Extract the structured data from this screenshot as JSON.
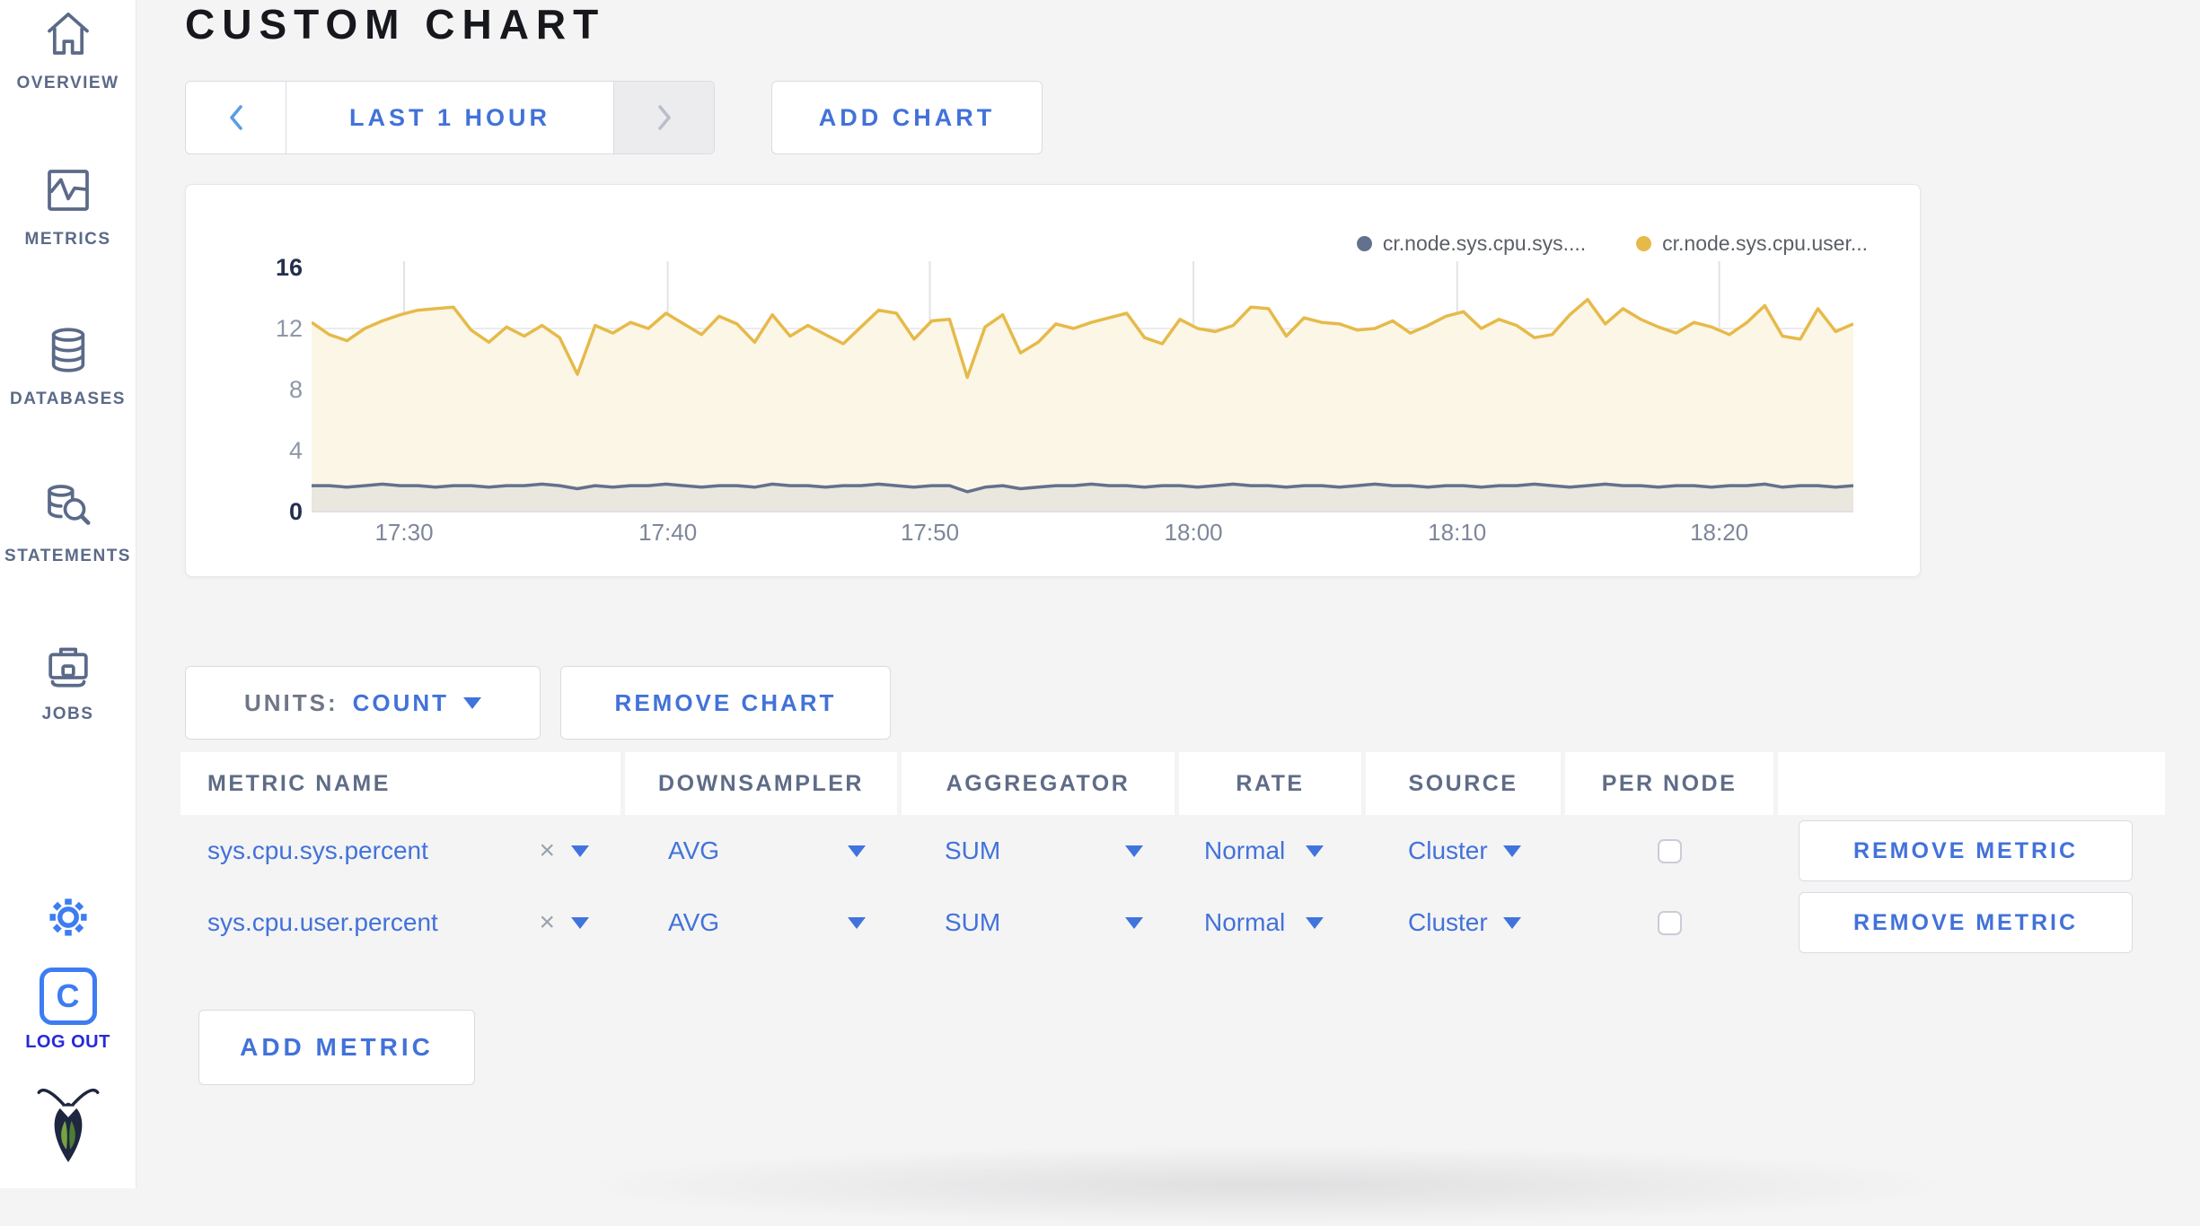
{
  "sidebar": {
    "items": [
      {
        "label": "OVERVIEW",
        "icon": "home-icon"
      },
      {
        "label": "METRICS",
        "icon": "metrics-icon"
      },
      {
        "label": "DATABASES",
        "icon": "databases-icon"
      },
      {
        "label": "STATEMENTS",
        "icon": "statements-icon"
      },
      {
        "label": "JOBS",
        "icon": "jobs-icon"
      }
    ],
    "logout_label": "LOG OUT",
    "logo_letter": "C"
  },
  "header": {
    "title": "CUSTOM CHART"
  },
  "toolbar": {
    "time_range_label": "LAST 1 HOUR",
    "add_chart_label": "ADD CHART"
  },
  "chart_controls": {
    "units_label": "UNITS:",
    "units_value": "COUNT",
    "remove_chart_label": "REMOVE CHART",
    "add_metric_label": "ADD METRIC"
  },
  "table": {
    "columns": [
      "METRIC NAME",
      "DOWNSAMPLER",
      "AGGREGATOR",
      "RATE",
      "SOURCE",
      "PER NODE"
    ],
    "rows": [
      {
        "metric": "sys.cpu.sys.percent",
        "clear": "×",
        "downsampler": "AVG",
        "aggregator": "SUM",
        "rate": "Normal",
        "source": "Cluster",
        "per_node_checked": false,
        "remove_label": "REMOVE METRIC"
      },
      {
        "metric": "sys.cpu.user.percent",
        "clear": "×",
        "downsampler": "AVG",
        "aggregator": "SUM",
        "rate": "Normal",
        "source": "Cluster",
        "per_node_checked": false,
        "remove_label": "REMOVE METRIC"
      }
    ]
  },
  "chart_data": {
    "type": "line",
    "title": "",
    "xlabel": "",
    "ylabel": "",
    "grid": true,
    "legend_position": "top-right",
    "y_ticks": [
      0,
      4,
      8,
      12,
      16
    ],
    "ylim": [
      0,
      16.5
    ],
    "x_ticks": [
      "17:30",
      "17:40",
      "17:50",
      "18:00",
      "18:10",
      "18:20"
    ],
    "x_tick_fractions": [
      0.06,
      0.231,
      0.401,
      0.572,
      0.743,
      0.913
    ],
    "series": [
      {
        "name": "cr.node.sys.cpu.sys....",
        "color": "#64718c",
        "fill": "#eae7df",
        "values": [
          1.7,
          1.7,
          1.6,
          1.7,
          1.8,
          1.7,
          1.7,
          1.6,
          1.7,
          1.7,
          1.6,
          1.7,
          1.7,
          1.8,
          1.7,
          1.5,
          1.7,
          1.6,
          1.7,
          1.7,
          1.8,
          1.7,
          1.6,
          1.7,
          1.7,
          1.6,
          1.8,
          1.7,
          1.7,
          1.6,
          1.7,
          1.7,
          1.8,
          1.7,
          1.6,
          1.7,
          1.7,
          1.3,
          1.6,
          1.7,
          1.5,
          1.6,
          1.7,
          1.7,
          1.8,
          1.7,
          1.7,
          1.6,
          1.7,
          1.7,
          1.6,
          1.7,
          1.8,
          1.7,
          1.7,
          1.6,
          1.7,
          1.7,
          1.6,
          1.7,
          1.8,
          1.7,
          1.7,
          1.6,
          1.7,
          1.7,
          1.6,
          1.7,
          1.7,
          1.8,
          1.7,
          1.6,
          1.7,
          1.8,
          1.7,
          1.7,
          1.6,
          1.7,
          1.7,
          1.6,
          1.7,
          1.7,
          1.8,
          1.6,
          1.7,
          1.7,
          1.6,
          1.7
        ]
      },
      {
        "name": "cr.node.sys.cpu.user...",
        "color": "#e6ba4a",
        "fill": "#fbf6e6",
        "values": [
          12.4,
          11.6,
          11.2,
          12.0,
          12.5,
          12.9,
          13.2,
          13.3,
          13.4,
          11.9,
          11.1,
          12.1,
          11.5,
          12.2,
          11.4,
          9.0,
          12.2,
          11.7,
          12.4,
          12.0,
          13.0,
          12.3,
          11.6,
          12.8,
          12.3,
          11.1,
          12.9,
          11.5,
          12.2,
          11.6,
          11.0,
          12.1,
          13.2,
          13.0,
          11.3,
          12.5,
          12.6,
          8.8,
          12.1,
          12.9,
          10.4,
          11.1,
          12.3,
          12.0,
          12.4,
          12.7,
          13.0,
          11.4,
          11.0,
          12.6,
          12.0,
          11.8,
          12.2,
          13.4,
          13.3,
          11.5,
          12.7,
          12.4,
          12.3,
          11.9,
          12.0,
          12.5,
          11.7,
          12.2,
          12.8,
          13.1,
          12.0,
          12.6,
          12.2,
          11.4,
          11.6,
          12.9,
          13.9,
          12.3,
          13.3,
          12.6,
          12.1,
          11.7,
          12.4,
          12.1,
          11.6,
          12.4,
          13.5,
          11.5,
          11.3,
          13.3,
          11.8,
          12.3
        ]
      }
    ]
  },
  "colors": {
    "accent_blue": "#4272d9",
    "icon_blue": "#3d7cf2",
    "slate": "#5b6a88",
    "page_bg": "#f4f4f5",
    "grid_v": "#e3e3e6",
    "grid_h": "#ececef"
  }
}
